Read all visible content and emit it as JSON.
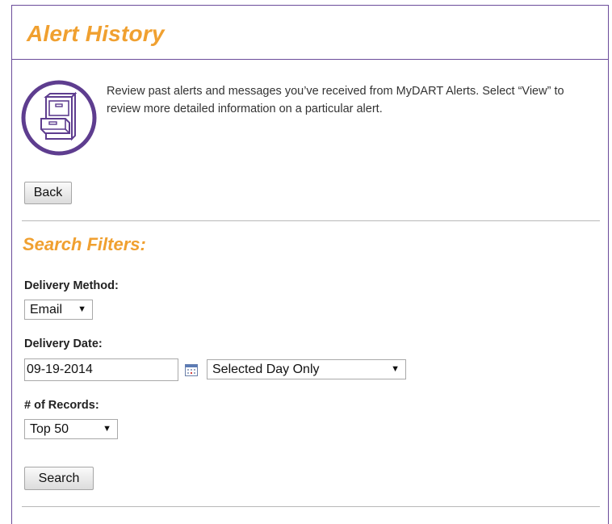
{
  "header": {
    "title": "Alert History"
  },
  "intro": {
    "icon": "file-cabinet-icon",
    "text": "Review past alerts and messages you’ve received from MyDART Alerts. Select “View” to review more detailed information on a particular alert."
  },
  "actions": {
    "back_label": "Back",
    "search_label": "Search"
  },
  "filters": {
    "title": "Search Filters:",
    "delivery_method": {
      "label": "Delivery Method:",
      "selected": "Email"
    },
    "delivery_date": {
      "label": "Delivery Date:",
      "value": "09-19-2014",
      "calendar_icon": "calendar-icon",
      "range_selected": "Selected Day Only"
    },
    "records": {
      "label": "# of Records:",
      "selected": "Top 50"
    }
  },
  "colors": {
    "accent_orange": "#f0a030",
    "border_purple": "#6b4c9a"
  }
}
